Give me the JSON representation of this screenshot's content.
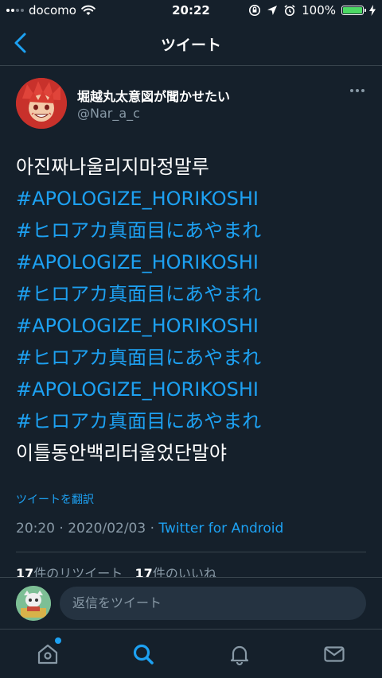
{
  "status_bar": {
    "carrier": "docomo",
    "time": "20:22",
    "battery": "100%"
  },
  "nav": {
    "title": "ツイート"
  },
  "tweet": {
    "display_name": "堀越丸太意図が聞かせたい",
    "handle": "@Nar_a_c",
    "lines": [
      {
        "text": "아진짜나울리지마정말루",
        "type": "text"
      },
      {
        "text": "#APOLOGIZE_HORIKOSHI",
        "type": "hashtag"
      },
      {
        "text": "#ヒロアカ真面目にあやまれ",
        "type": "hashtag"
      },
      {
        "text": "#APOLOGIZE_HORIKOSHI",
        "type": "hashtag"
      },
      {
        "text": "#ヒロアカ真面目にあやまれ",
        "type": "hashtag"
      },
      {
        "text": "#APOLOGIZE_HORIKOSHI",
        "type": "hashtag"
      },
      {
        "text": "#ヒロアカ真面目にあやまれ",
        "type": "hashtag"
      },
      {
        "text": "#APOLOGIZE_HORIKOSHI",
        "type": "hashtag"
      },
      {
        "text": "#ヒロアカ真面目にあやまれ",
        "type": "hashtag"
      },
      {
        "text": "이틀동안백리터울었단말야",
        "type": "text"
      }
    ],
    "translate_label": "ツイートを翻訳",
    "timestamp": "20:20 · 2020/02/03 · ",
    "source": "Twitter for Android",
    "retweet_count": "17",
    "retweet_label": "件のリツイート",
    "like_count": "17",
    "like_label": "件のいいね"
  },
  "reply": {
    "placeholder": "返信をツイート"
  },
  "tabs": {
    "home": "home-icon",
    "search": "search-icon",
    "notifications": "bell-icon",
    "messages": "mail-icon"
  },
  "colors": {
    "background": "#15202b",
    "accent": "#1da1f2",
    "secondary_text": "#8899a6",
    "divider": "#38444d"
  }
}
